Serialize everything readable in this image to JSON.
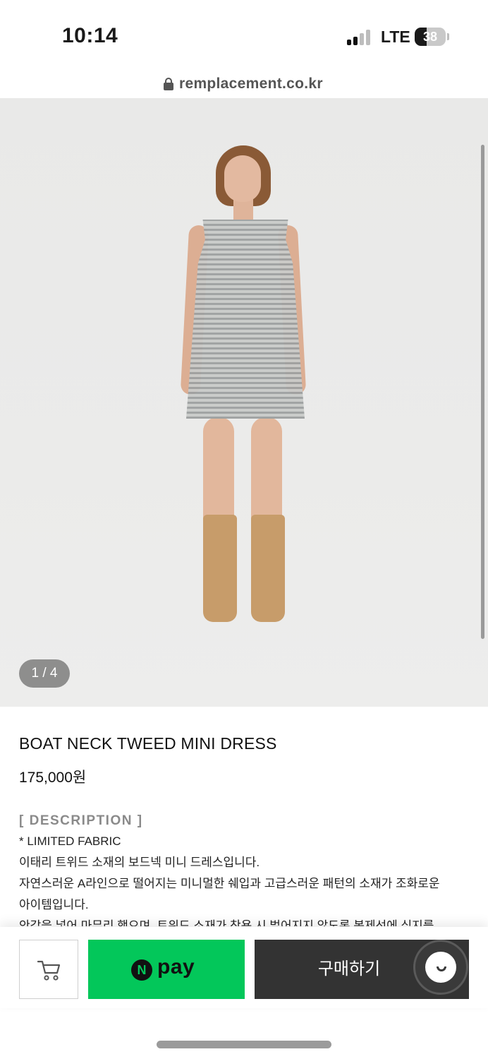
{
  "status_bar": {
    "time": "10:14",
    "network": "LTE",
    "battery": "38",
    "battery_level": 0.38,
    "signal_bars_active": 2,
    "signal_bars_total": 4
  },
  "browser": {
    "domain": "remplacement.co.kr"
  },
  "gallery": {
    "counter": "1 / 4"
  },
  "product": {
    "name": "BOAT NECK TWEED MINI DRESS",
    "price": "175,000원"
  },
  "description": {
    "heading": "[ DESCRIPTION ]",
    "lines": [
      "* LIMITED FABRIC",
      "이태리 트위드 소재의 보드넥 미니 드레스입니다.",
      "자연스러운 A라인으로 떨어지는 미니멀한 쉐입과 고급스러운 패턴의 소재가 조화로운",
      "아이템입니다.",
      "안감을 넣어 마무리 했으며, 트위드 소재가 착용 시 벌어지지 않도록 봉제선에 심지를"
    ]
  },
  "action_bar": {
    "npay_mark": "N",
    "npay_label": "pay",
    "buy_label": "구매하기"
  },
  "colors": {
    "npay_green": "#03c75a",
    "buy_dark": "#333333",
    "muted_text": "#8a8a8a"
  },
  "icons": {
    "lock": "lock-icon",
    "cart": "cart-icon",
    "chat": "chat-icon"
  }
}
